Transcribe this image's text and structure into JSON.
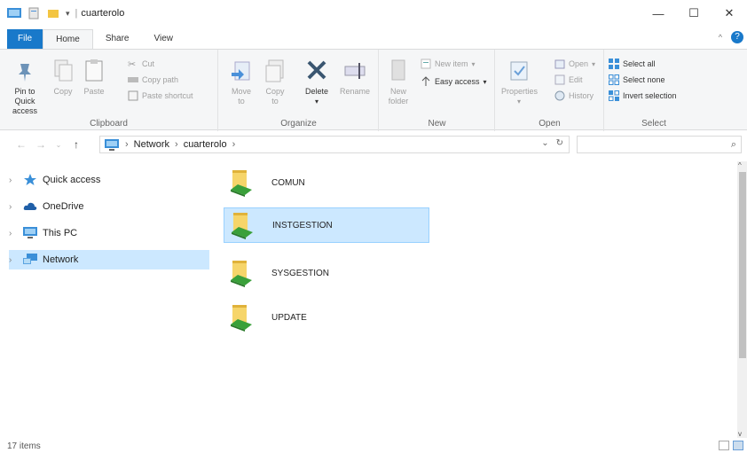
{
  "window": {
    "title": "cuarterolo",
    "controls": {
      "minimize": "—",
      "maximize": "☐",
      "close": "✕"
    }
  },
  "tabs": [
    {
      "label": "File"
    },
    {
      "label": "Home"
    },
    {
      "label": "Share"
    },
    {
      "label": "View"
    }
  ],
  "ribbon": {
    "clipboard": {
      "label": "Clipboard",
      "pin": "Pin to Quick access",
      "copy": "Copy",
      "paste": "Paste",
      "cut": "Cut",
      "copy_path": "Copy path",
      "paste_shortcut": "Paste shortcut"
    },
    "organize": {
      "label": "Organize",
      "move_to": "Move to",
      "copy_to": "Copy to",
      "delete": "Delete",
      "rename": "Rename"
    },
    "new": {
      "label": "New",
      "new_folder": "New folder",
      "new_item": "New item",
      "easy_access": "Easy access"
    },
    "open": {
      "label": "Open",
      "properties": "Properties",
      "open": "Open",
      "edit": "Edit",
      "history": "History"
    },
    "select": {
      "label": "Select",
      "select_all": "Select all",
      "select_none": "Select none",
      "invert_selection": "Invert selection"
    }
  },
  "address": {
    "crumbs": [
      "Network",
      "cuarterolo"
    ],
    "search_placeholder": ""
  },
  "nav": [
    {
      "label": "Quick access",
      "icon": "star-icon"
    },
    {
      "label": "OneDrive",
      "icon": "cloud-icon"
    },
    {
      "label": "This PC",
      "icon": "computer-icon"
    },
    {
      "label": "Network",
      "icon": "network-icon"
    }
  ],
  "folders": [
    {
      "name": "COMUN"
    },
    {
      "name": "INSTGESTION"
    },
    {
      "name": "SYSGESTION"
    },
    {
      "name": "UPDATE"
    }
  ],
  "status": {
    "count": "17 items"
  },
  "colors": {
    "accent": "#1979ca",
    "selection": "#cce8ff",
    "folder": "#f3c542"
  }
}
